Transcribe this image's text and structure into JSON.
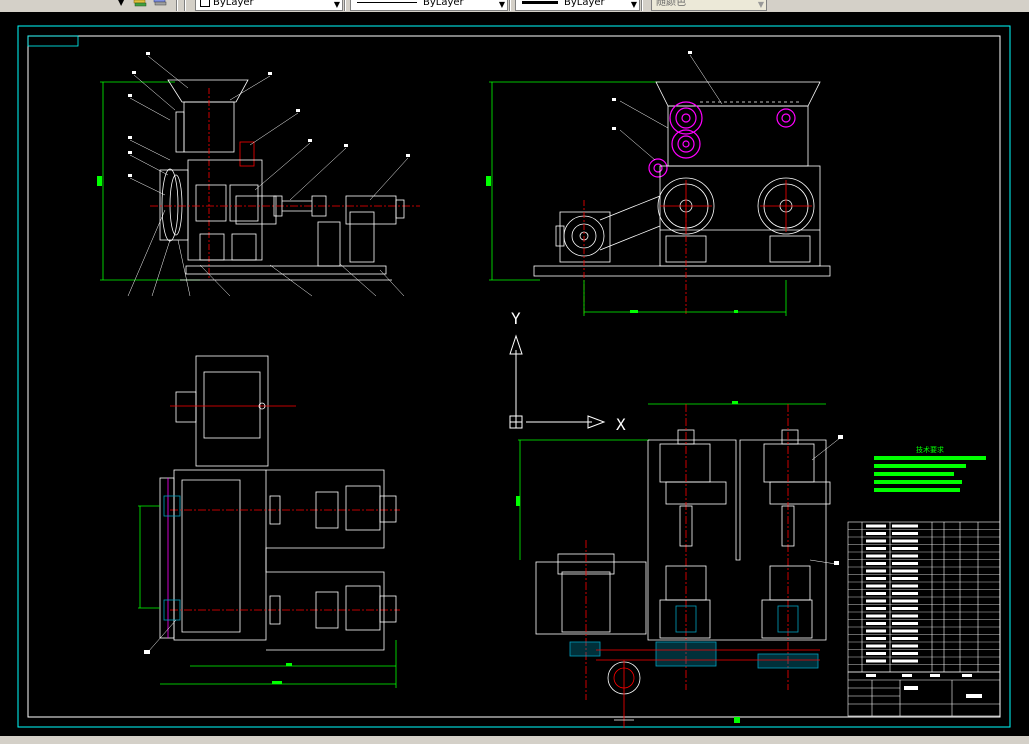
{
  "toolbar": {
    "layer_control": {
      "value": "ByLayer"
    },
    "linetype_control": {
      "value": "ByLayer"
    },
    "lineweight_control": {
      "value": "ByLayer"
    },
    "plotstyle_control": {
      "value": "随颜色"
    }
  },
  "drawing": {
    "ucs_y_label": "Y",
    "ucs_x_label": "X",
    "tech_requirements_title": "技术要求",
    "colors": {
      "background": "#000000",
      "outline": "#ffffff",
      "centerline": "#ff0000",
      "dimension": "#00ff00",
      "border": "#00ffff",
      "gear": "#ff00ff",
      "section": "#00a0c0"
    }
  }
}
